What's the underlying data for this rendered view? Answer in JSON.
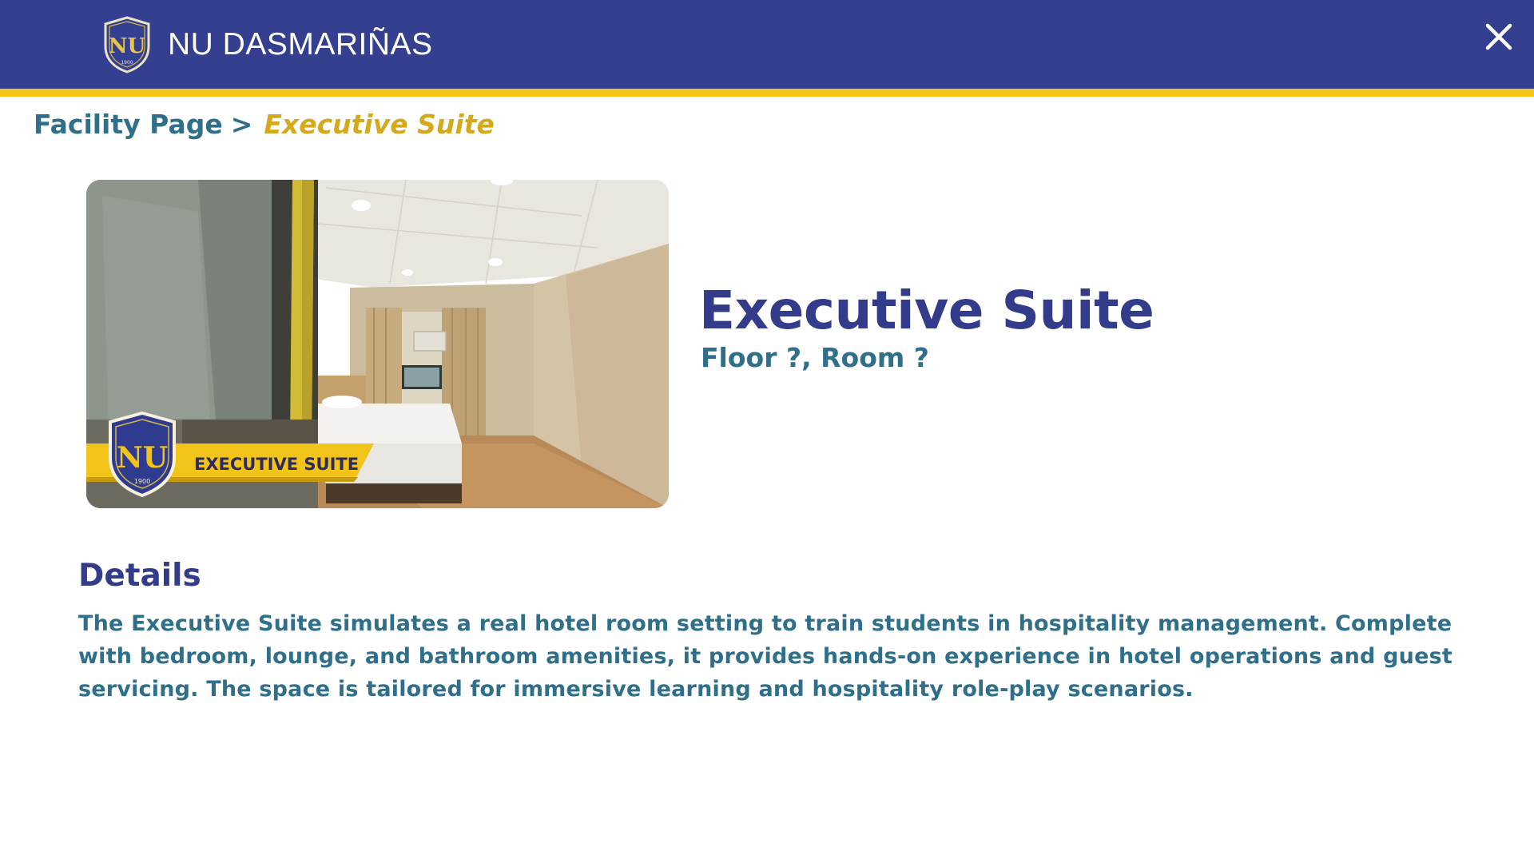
{
  "header": {
    "brand_name": "NU DASMARIÑAS",
    "logo_text": "NU",
    "logo_year": "1900",
    "bar_color": "#353f8f",
    "stripe_color": "#f2c318",
    "close_icon": "close-icon"
  },
  "breadcrumb": {
    "parent_label": "Facility Page",
    "separator": ">",
    "current_label": "Executive Suite"
  },
  "facility": {
    "photo_banner": "EXECUTIVE SUITE",
    "title": "Executive Suite",
    "location": "Floor ?, Room ?"
  },
  "details": {
    "heading": "Details",
    "body": "The Executive Suite simulates a real hotel room setting to train students in hospitality management. Complete with bedroom, lounge, and bathroom amenities, it provides hands-on experience in hotel operations and guest servicing. The space is tailored for immersive learning and hospitality role-play scenarios."
  }
}
